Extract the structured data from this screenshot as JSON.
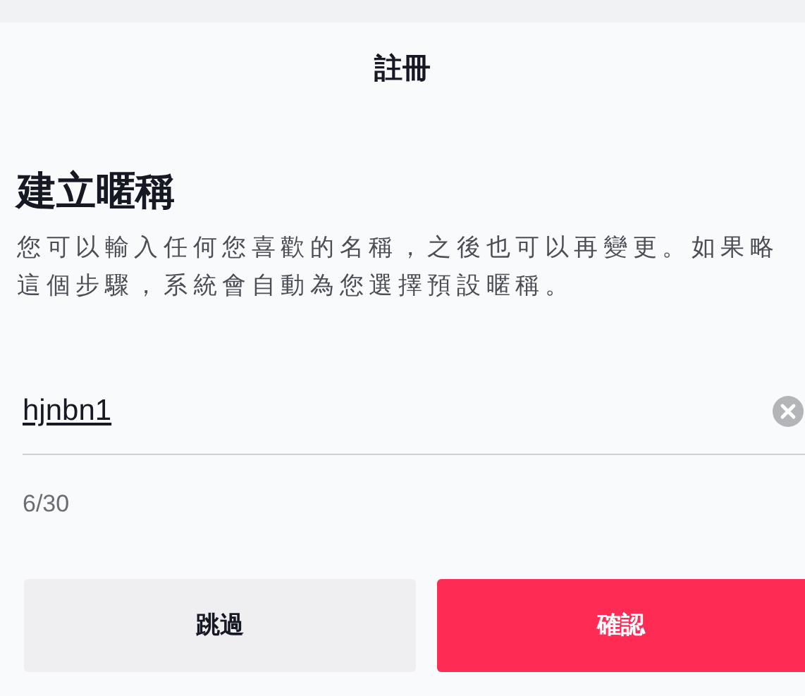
{
  "header": {
    "title": "註冊"
  },
  "heading": "建立暱稱",
  "description": [
    "您可以輸入任何您喜歡的名稱，之後也可以再變更。如果略",
    "這個步驟，系統會自動為您選擇預設暱稱。"
  ],
  "nickname_field": {
    "value": "hjnbn1",
    "counter": "6/30"
  },
  "buttons": [
    {
      "label": "跳過",
      "kind": "secondary"
    },
    {
      "label": "確認",
      "kind": "primary"
    }
  ]
}
